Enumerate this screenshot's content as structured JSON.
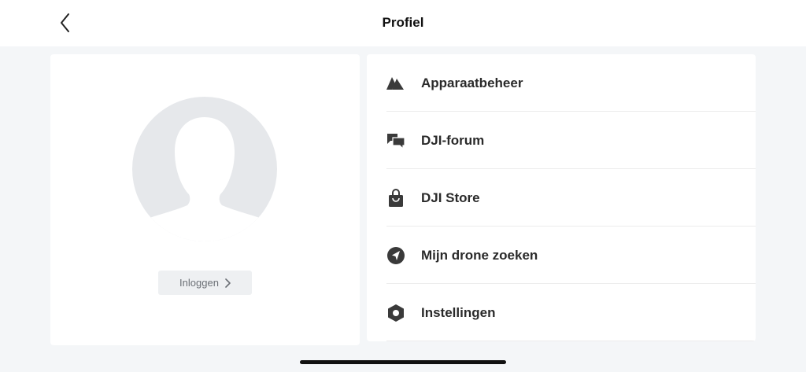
{
  "header": {
    "title": "Profiel",
    "back_icon": "chevron-left-icon"
  },
  "profile": {
    "avatar_icon": "user-silhouette-icon",
    "login_label": "Inloggen",
    "login_chevron_icon": "chevron-right-icon"
  },
  "menu": {
    "items": [
      {
        "label": "Apparaatbeheer",
        "icon": "device-management-icon"
      },
      {
        "label": "DJI-forum",
        "icon": "chat-bubbles-icon"
      },
      {
        "label": "DJI Store",
        "icon": "shopping-bag-icon"
      },
      {
        "label": "Mijn drone zoeken",
        "icon": "compass-locate-icon"
      },
      {
        "label": "Instellingen",
        "icon": "settings-hexagon-icon"
      }
    ]
  },
  "colors": {
    "background": "#f4f6f8",
    "card": "#ffffff",
    "icon": "#3a3a3a",
    "avatar": "#e6e8eb"
  }
}
